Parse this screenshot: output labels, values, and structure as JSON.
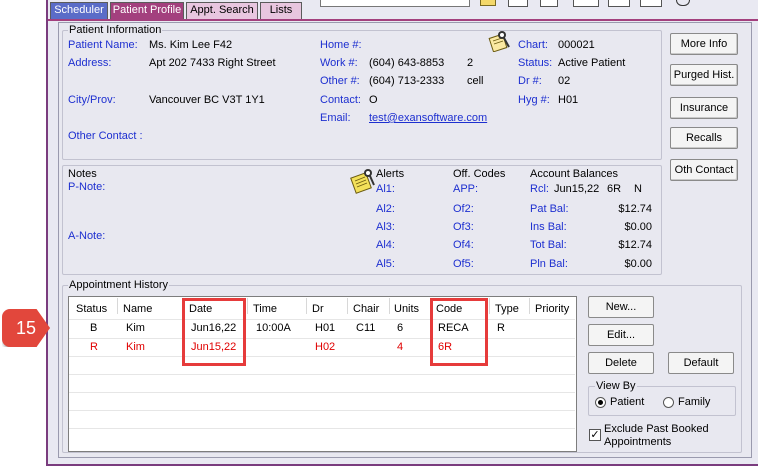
{
  "tabs": [
    "Scheduler",
    "Patient Profile",
    "Appt. Search",
    "Lists"
  ],
  "patient_info": {
    "section_title": "Patient Information",
    "name_label": "Patient Name:",
    "name": "Ms. Kim Lee F42",
    "address_label": "Address:",
    "address": "Apt 202 7433 Right Street",
    "city_label": "City/Prov:",
    "city": "Vancouver BC V3T 1Y1",
    "other_contact_label": "Other Contact :",
    "home_label": "Home #:",
    "home": "",
    "work_label": "Work #:",
    "work": "(604) 643-8853",
    "work_ext": "2",
    "other_label": "Other #:",
    "other": "(604) 713-2333",
    "other_type": "cell",
    "contact_label": "Contact:",
    "contact": "O",
    "email_label": "Email:",
    "email": "test@exansoftware.com",
    "chart_label": "Chart:",
    "chart": "000021",
    "status_label": "Status:",
    "status": "Active Patient",
    "dr_label": "Dr #:",
    "dr": "02",
    "hyg_label": "Hyg #:",
    "hyg": "H01"
  },
  "side_buttons": [
    "More Info",
    "Purged Hist.",
    "Insurance",
    "Recalls",
    "Oth Contact"
  ],
  "notes": {
    "title": "Notes",
    "p_note": "P-Note:",
    "a_note": "A-Note:",
    "alerts_title": "Alerts",
    "alerts": [
      "Al1:",
      "Al2:",
      "Al3:",
      "Al4:",
      "Al5:"
    ],
    "off_codes_title": "Off. Codes",
    "off_codes": [
      "APP:",
      "Of2:",
      "Of3:",
      "Of4:",
      "Of5:"
    ]
  },
  "balances": {
    "title": "Account Balances",
    "rcl_label": "Rcl:",
    "rcl_date": "Jun15,22",
    "rcl_code": "6R",
    "rcl_flag": "N",
    "rows": [
      {
        "label": "Pat Bal:",
        "value": "$12.74"
      },
      {
        "label": "Ins Bal:",
        "value": "$0.00"
      },
      {
        "label": "Tot Bal:",
        "value": "$12.74"
      },
      {
        "label": "Pln Bal:",
        "value": "$0.00"
      }
    ]
  },
  "appointment_history": {
    "title": "Appointment History",
    "columns": [
      "Status",
      "Name",
      "Date",
      "Time",
      "Dr",
      "Chair",
      "Units",
      "Code",
      "Type",
      "Priority"
    ],
    "rows": [
      {
        "status": "B",
        "name": "Kim",
        "date": "Jun16,22",
        "time": "10:00A",
        "dr": "H01",
        "chair": "C11",
        "units": "6",
        "code": "RECA",
        "type": "R",
        "priority": ""
      },
      {
        "status": "R",
        "name": "Kim",
        "date": "Jun15,22",
        "time": "",
        "dr": "H02",
        "chair": "",
        "units": "4",
        "code": "6R",
        "type": "",
        "priority": ""
      }
    ],
    "buttons": {
      "new": "New...",
      "edit": "Edit...",
      "delete": "Delete",
      "default": "Default"
    },
    "view_by": {
      "title": "View By",
      "patient": "Patient",
      "family": "Family",
      "selected": "Patient"
    },
    "exclude_label_1": "Exclude Past Booked",
    "exclude_label_2": "Appointments",
    "exclude_checked": true
  },
  "callout": "15",
  "colors": {
    "accent_red": "#e63b3b",
    "tab_active": "#a3407e",
    "link_blue": "#1d2fd0"
  }
}
